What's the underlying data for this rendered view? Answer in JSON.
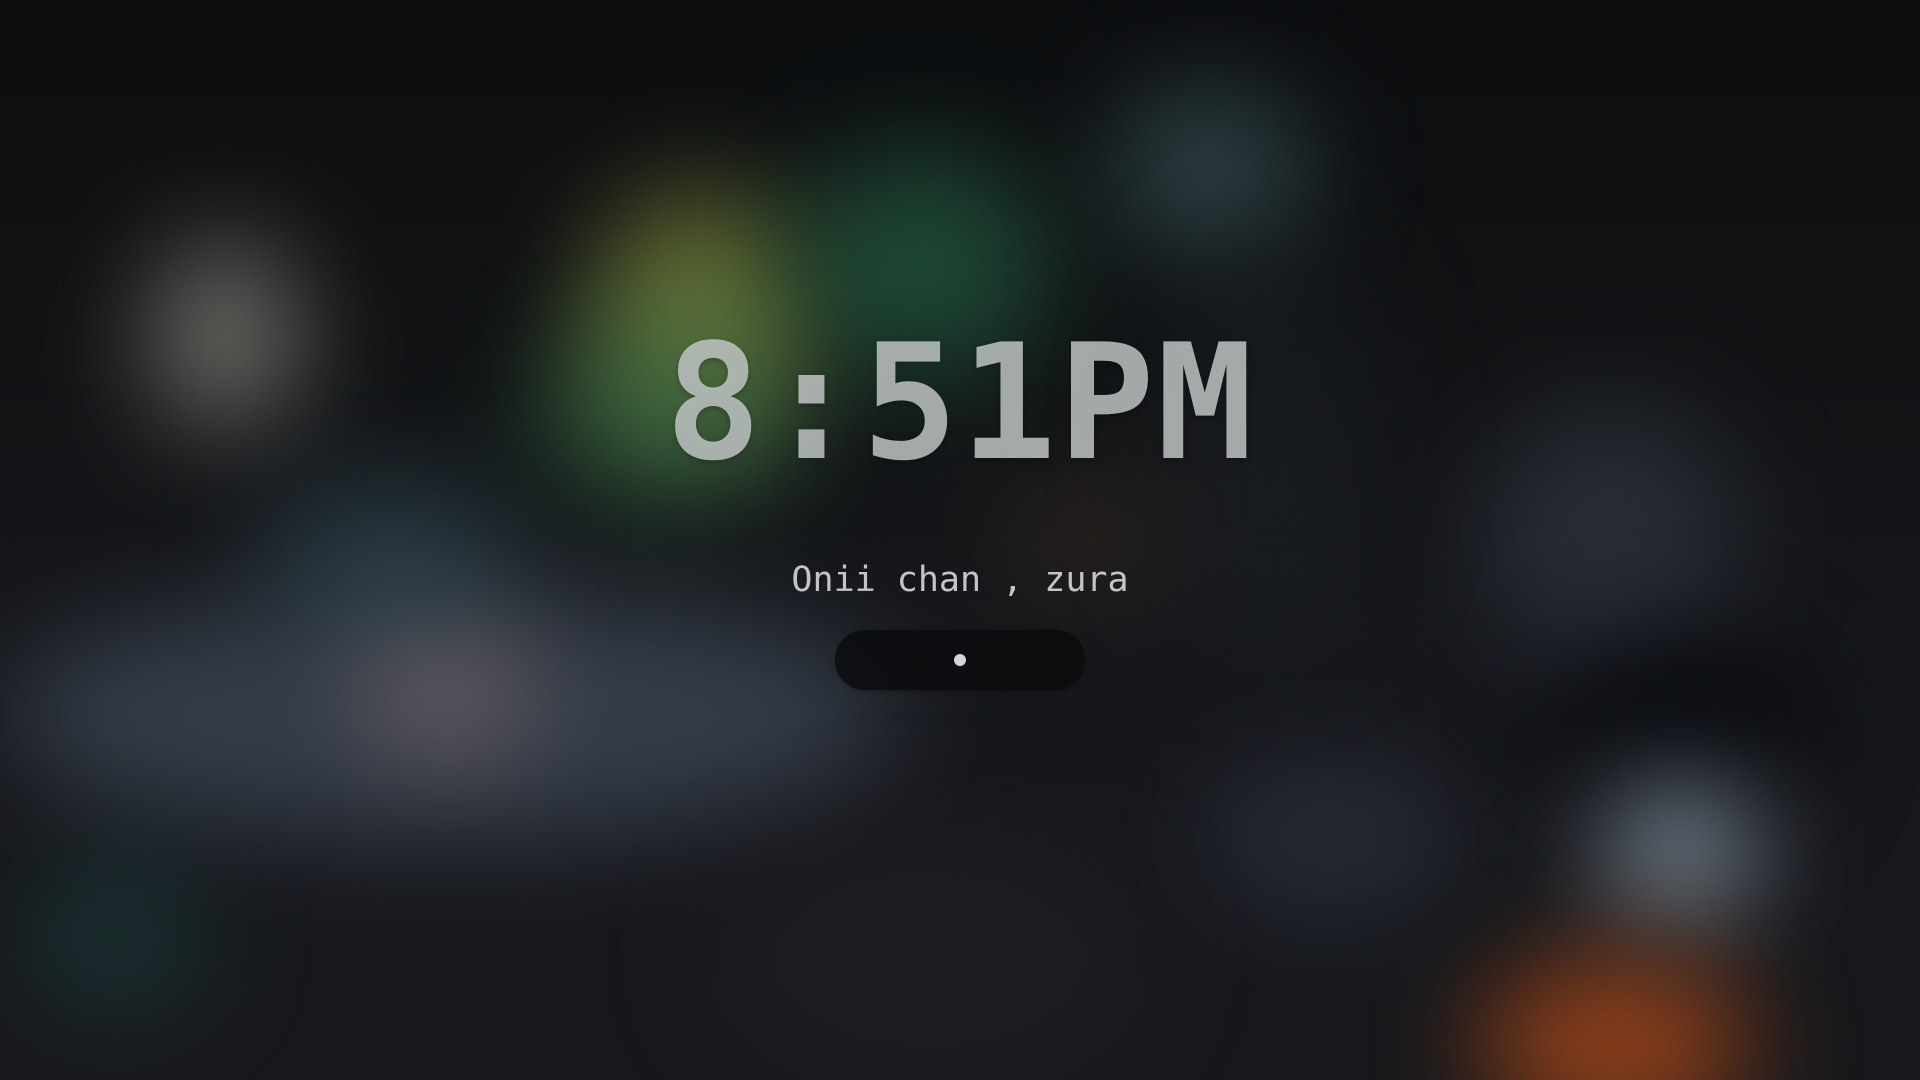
{
  "lockscreen": {
    "time": "8:51PM",
    "greeting": "Onii chan , zura",
    "password": {
      "masked_characters": 1,
      "dot_color": "#d3d6d9",
      "background_color": "#0a0c0e"
    }
  },
  "colors": {
    "text": "#c3c5c8",
    "background": "#121316"
  }
}
